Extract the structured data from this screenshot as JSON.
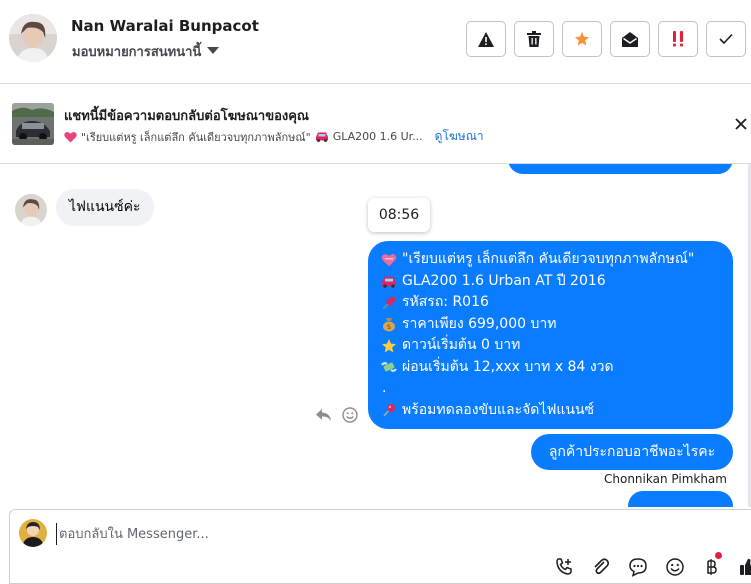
{
  "header": {
    "contact_name": "Nan Waralai Bunpacot",
    "assign_label": "มอบหมายการสนทนานี้",
    "actions": [
      {
        "name": "report-spam-button",
        "icon": "warning-icon",
        "color": "#1c1e21"
      },
      {
        "name": "delete-button",
        "icon": "trash-icon",
        "color": "#1c1e21"
      },
      {
        "name": "star-button",
        "icon": "star-icon",
        "color": "#f7923b"
      },
      {
        "name": "mark-unread-button",
        "icon": "envelope-open-icon",
        "color": "#1c1e21"
      },
      {
        "name": "follow-up-button",
        "icon": "double-exclamation-icon",
        "color": "#e41e3f"
      },
      {
        "name": "mark-done-button",
        "icon": "check-icon",
        "color": "#1c1e21"
      }
    ]
  },
  "ad_banner": {
    "title": "แชทนี้มีข้อความตอบกลับต่อโฆษณาของคุณ",
    "subtitle": "\"เรียบแต่หรู เล็กแต่ลึก คันเดียวจบทุกภาพลักษณ์\"",
    "subtitle_suffix": "GLA200 1.6 Ur...",
    "link": "ดูโฆษณา"
  },
  "messages": {
    "incoming_text": "ไฟแนนซ์ค่ะ",
    "time": "08:56",
    "ad_lines": [
      {
        "icon": "heart-icon",
        "text": "\"เรียบแต่หรู เล็กแต่ลึก คันเดียวจบทุกภาพลักษณ์\""
      },
      {
        "icon": "car-icon",
        "text": "GLA200 1.6 Urban AT ปี 2016"
      },
      {
        "icon": "pin-icon",
        "text": "รหัสรถ: R016"
      },
      {
        "icon": "money-bag-icon",
        "text": "ราคาเพียง 699,000 บาท"
      },
      {
        "icon": "star-icon",
        "text": "ดาวน์เริ่มต้น 0 บาท"
      },
      {
        "icon": "money-wings-icon",
        "text": "ผ่อนเริ่มต้น 12,xxx บาท x 84 งวด"
      },
      {
        "icon": "",
        "text": "."
      },
      {
        "icon": "round-pin-icon",
        "text": "พร้อมทดลองขับและจัดไฟแนนซ์"
      }
    ],
    "reply_text": "ลูกค้าประกอบอาชีพอะไรคะ",
    "sender": "Chonnikan Pimkham"
  },
  "composer": {
    "placeholder": "ตอบกลับใน Messenger...",
    "tools": [
      "phone-icon",
      "paperclip-icon",
      "saved-reply-icon",
      "emoji-icon",
      "baht-icon",
      "thumbs-up-icon"
    ]
  },
  "colors": {
    "accent": "#0a7cff",
    "link": "#216fdb",
    "incoming_bubble": "#f0f2f5"
  }
}
